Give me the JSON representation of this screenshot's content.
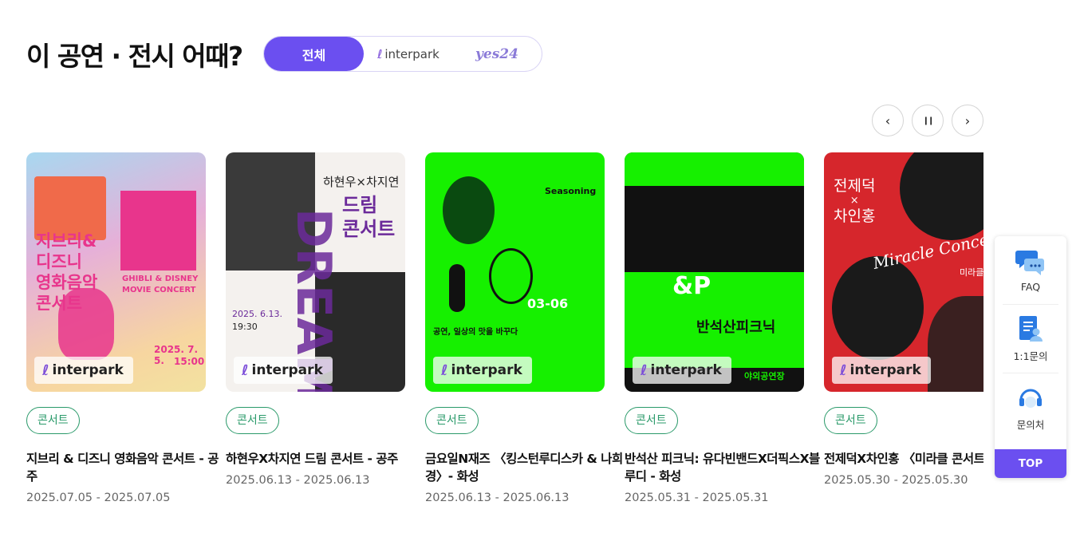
{
  "section": {
    "title": "이 공연 · 전시 어때?"
  },
  "filters": [
    {
      "label": "전체",
      "active": true
    },
    {
      "label": "interpark",
      "active": false
    },
    {
      "label": "yes24",
      "active": false
    }
  ],
  "carousel_controls": {
    "prev": "‹",
    "pause": "❙❙",
    "next": "›"
  },
  "cards": [
    {
      "poster": {
        "lines": [
          "지브리&",
          "디즈니",
          "영화음악",
          "콘서트"
        ],
        "sub": "GHIBLI & DISNEY MOVIE CONCERT",
        "date": "2025. 7. 5.",
        "time": "15:00"
      },
      "vendor": "interpark",
      "category": "콘서트",
      "title": "지브리 & 디즈니 영화음악 콘서트 - 공주",
      "date": "2025.07.05 - 2025.07.05"
    },
    {
      "poster": {
        "lines": [
          "하현우×차지연",
          "드림",
          "콘서트"
        ],
        "big": "DREAM",
        "date": "2025. 6.13.",
        "time": "19:30"
      },
      "vendor": "interpark",
      "category": "콘서트",
      "title": "하현우X차지연 드림 콘서트 - 공주",
      "date": "2025.06.13 - 2025.06.13"
    },
    {
      "poster": {
        "lines": [
          "Seasoning"
        ],
        "big": "03-06",
        "sub": "공연, 일상의 맛을 바꾸다"
      },
      "vendor": "interpark",
      "category": "콘서트",
      "title": "금요일N재즈 〈킹스턴루디스카 & 나희경〉- 화성",
      "date": "2025.06.13 - 2025.06.13"
    },
    {
      "poster": {
        "lines": [
          "반석산피크닉"
        ],
        "big": "&P",
        "sub": "야외공연장"
      },
      "vendor": "interpark",
      "category": "콘서트",
      "title": "반석산 피크닉: 유다빈밴드X더픽스X블루디 - 화성",
      "date": "2025.05.31 - 2025.05.31"
    },
    {
      "poster": {
        "lines": [
          "전제덕",
          "×",
          "차인홍"
        ],
        "big": "Miracle Concert",
        "sub": "미라클 콘"
      },
      "vendor": "interpark",
      "category": "콘서트",
      "title": "전제덕X차인홍 〈미라클 콘서트〉 - 공주",
      "date": "2025.05.30 - 2025.05.30"
    }
  ],
  "side_panel": {
    "items": [
      {
        "label": "FAQ",
        "icon": "chat-bubbles-icon"
      },
      {
        "label": "1:1문의",
        "icon": "document-user-icon"
      },
      {
        "label": "문의처",
        "icon": "headset-icon"
      }
    ],
    "top_label": "TOP"
  },
  "colors": {
    "accent": "#6b4ff0",
    "category_green": "#2a9a6a",
    "interpark_purple": "#7a4bd8"
  }
}
